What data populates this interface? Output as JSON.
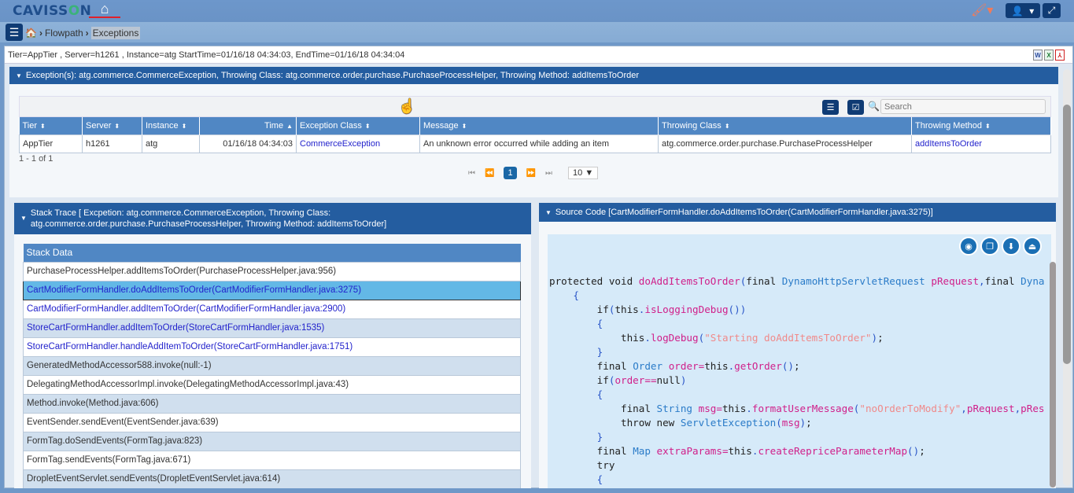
{
  "header": {
    "logo_text_a": "CAVISS",
    "logo_text_o": "O",
    "logo_text_b": "N",
    "home_icon": "home-icon",
    "theme_icon": "paint-bucket-icon",
    "user_icon": "user-icon",
    "expand_icon": "expand-icon"
  },
  "breadcrumb": {
    "items": [
      "Flowpath",
      "Exceptions"
    ]
  },
  "infobar": {
    "text": "Tier=AppTier , Server=h1261 , Instance=atg StartTime=01/16/18 04:34:03, EndTime=01/16/18 04:34:04",
    "export_icons": [
      "word-export-icon",
      "excel-export-icon",
      "pdf-export-icon"
    ]
  },
  "exception_panel": {
    "title": "Exception(s): atg.commerce.CommerceException, Throwing Class: atg.commerce.order.purchase.PurchaseProcessHelper, Throwing Method: addItemsToOrder",
    "search_placeholder": "Search",
    "columns": [
      "Tier",
      "Server",
      "Instance",
      "Time",
      "Exception Class",
      "Message",
      "Throwing Class",
      "Throwing Method"
    ],
    "rows": [
      {
        "tier": "AppTier",
        "server": "h1261",
        "instance": "atg",
        "time": "01/16/18 04:34:03",
        "exception_class": "CommerceException",
        "message": "An unknown error occurred while adding an item",
        "throwing_class": "atg.commerce.order.purchase.PurchaseProcessHelper",
        "throwing_method": "addItemsToOrder"
      }
    ],
    "records_text": "1 - 1 of 1",
    "pager": {
      "current_page": "1",
      "rows_per_page": "10 ▼"
    }
  },
  "stack_panel": {
    "title_line1": "Stack Trace [ Excpetion: atg.commerce.CommerceException, Throwing Class:",
    "title_line2": "atg.commerce.order.purchase.PurchaseProcessHelper, Throwing Method: addItemsToOrder]",
    "column": "Stack Data",
    "rows": [
      {
        "text": "PurchaseProcessHelper.addItemsToOrder(PurchaseProcessHelper.java:956)",
        "link": false
      },
      {
        "text": "CartModifierFormHandler.doAddItemsToOrder(CartModifierFormHandler.java:3275)",
        "link": true,
        "selected": true
      },
      {
        "text": "CartModifierFormHandler.addItemToOrder(CartModifierFormHandler.java:2900)",
        "link": true
      },
      {
        "text": "StoreCartFormHandler.addItemToOrder(StoreCartFormHandler.java:1535)",
        "link": true
      },
      {
        "text": "StoreCartFormHandler.handleAddItemToOrder(StoreCartFormHandler.java:1751)",
        "link": true
      },
      {
        "text": "GeneratedMethodAccessor588.invoke(null:-1)",
        "link": false
      },
      {
        "text": "DelegatingMethodAccessorImpl.invoke(DelegatingMethodAccessorImpl.java:43)",
        "link": false
      },
      {
        "text": "Method.invoke(Method.java:606)",
        "link": false
      },
      {
        "text": "EventSender.sendEvent(EventSender.java:639)",
        "link": false
      },
      {
        "text": "FormTag.doSendEvents(FormTag.java:823)",
        "link": false
      },
      {
        "text": "FormTag.sendEvents(FormTag.java:671)",
        "link": false
      },
      {
        "text": "DropletEventServlet.sendEvents(DropletEventServlet.java:614)",
        "link": false
      }
    ]
  },
  "source_panel": {
    "title": "Source Code [CartModifierFormHandler.doAddItemsToOrder(CartModifierFormHandler.java:3275)]",
    "actions": [
      "camera-icon",
      "copy-icon",
      "download-icon",
      "inbox-upload-icon"
    ],
    "code_lines": [
      "protected void doAddItemsToOrder(final DynamoHttpServletRequest pRequest,final Dyna",
      "    {",
      "        if(this.isLoggingDebug())",
      "        {",
      "            this.logDebug(\"Starting doAddItemsToOrder\");",
      "        }",
      "        final Order order=this.getOrder();",
      "        if(order==null)",
      "        {",
      "            final String msg=this.formatUserMessage(\"noOrderToModify\",pRequest,pRes",
      "            throw new ServletException(msg);",
      "        }",
      "        final Map extraParams=this.createRepriceParameterMap();",
      "        try",
      "        {"
    ]
  }
}
